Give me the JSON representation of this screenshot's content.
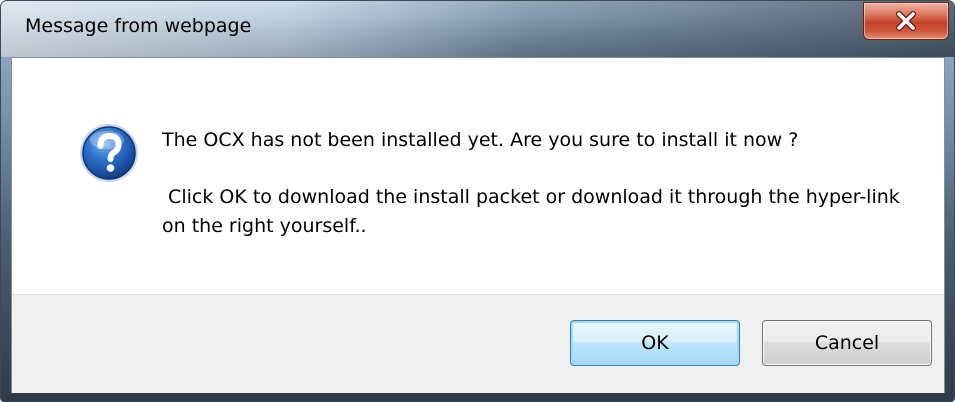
{
  "window": {
    "title": "Message from webpage",
    "close_icon": "close-icon"
  },
  "message": {
    "icon": "question-icon",
    "line1": "The OCX has not been installed yet. Are you sure to install it now ?",
    "line2": " Click OK to download the install packet or download it through the hyper-link on the right yourself.."
  },
  "buttons": {
    "ok_label": "OK",
    "cancel_label": "Cancel"
  },
  "colors": {
    "close_button": "#c4412a",
    "ok_border": "#3c7fb1",
    "question_icon": "#1f5fb8"
  }
}
